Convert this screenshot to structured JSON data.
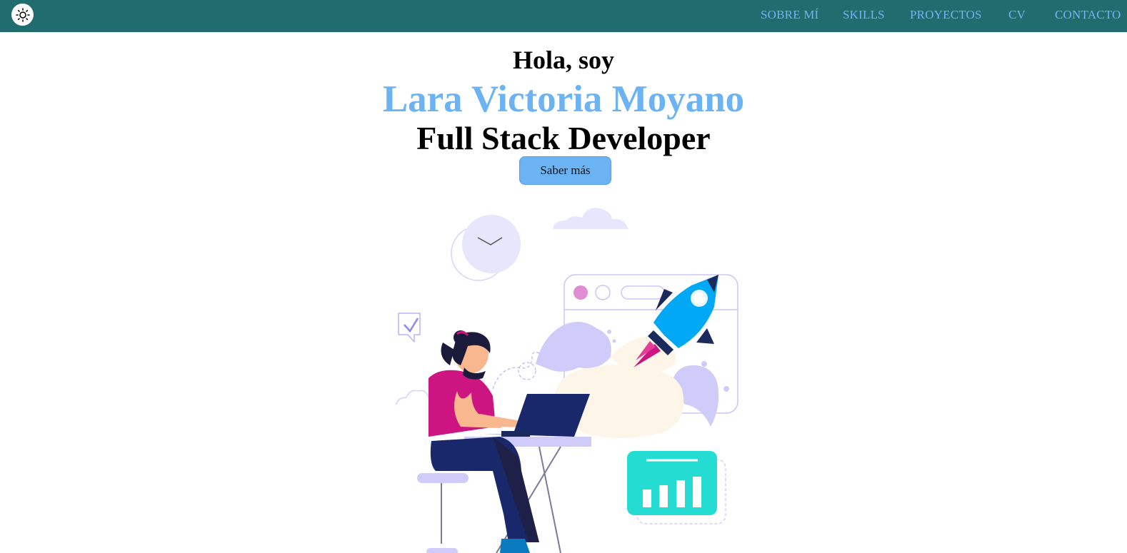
{
  "nav": {
    "theme_icon": "sun-icon",
    "links": [
      "SOBRE MÍ",
      "SKILLS",
      "PROYECTOS",
      "CV",
      "CONTACTO"
    ]
  },
  "hero": {
    "greeting": "Hola, soy",
    "name": "Lara Victoria Moyano",
    "role": "Full Stack Developer",
    "cta_label": "Saber más"
  },
  "illustration": {
    "icons": [
      "clock-icon",
      "cloud-icon",
      "browser-window-icon",
      "rocket-icon",
      "checkmark-bubble-icon",
      "developer-at-laptop",
      "bar-chart-card-icon"
    ]
  },
  "colors": {
    "navbar": "#206c6e",
    "nav_link": "#70b4f4",
    "accent": "#6bb3f2",
    "illustration_lavender": "#d4d1fb",
    "shirt": "#cc1580",
    "teal_card": "#24dcd2",
    "rocket": "#00a8f5"
  }
}
